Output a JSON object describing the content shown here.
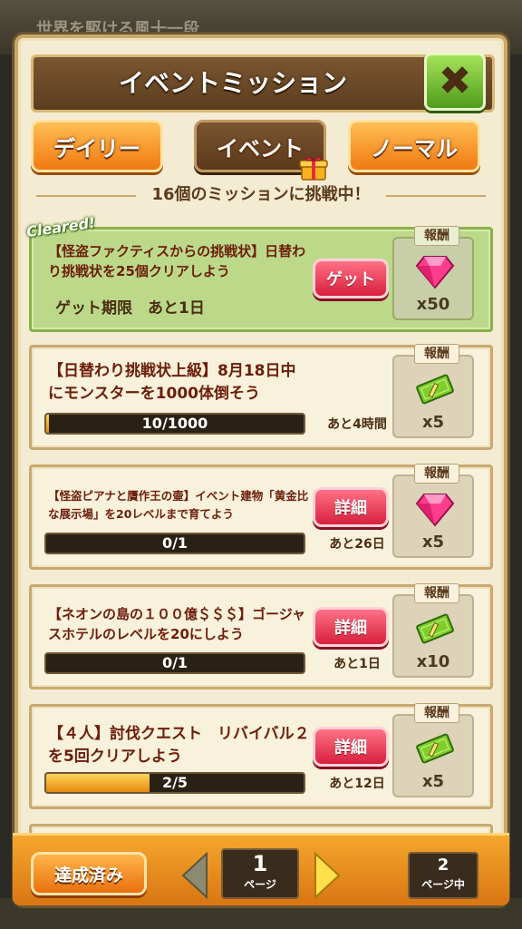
{
  "background": {
    "top_text": "世界を駆ける風十一段"
  },
  "header": {
    "title": "イベントミッション",
    "close_icon": "close-x-icon"
  },
  "tabs": [
    {
      "label": "デイリー",
      "active": false
    },
    {
      "label": "イベント",
      "active": true
    },
    {
      "label": "ノーマル",
      "active": false
    }
  ],
  "subtitle": "16個のミッションに挑戦中！",
  "reward_label": "報酬",
  "missions": [
    {
      "title": "【怪盗ファクティスからの挑戦状】日替わり挑戦状を25個クリアしよう",
      "cleared_badge": "Cleared!",
      "deadline": "ゲット期限　あと1日",
      "button": "ゲット",
      "reward_icon": "gem-icon",
      "reward_qty": "x50"
    },
    {
      "title": "【日替わり挑戦状上級】8月18日中にモンスターを1000体倒そう",
      "progress_text": "10/1000",
      "progress_fraction": 0.01,
      "remaining": "あと4時間",
      "reward_icon": "ticket-icon",
      "reward_qty": "x5"
    },
    {
      "title": "【怪盗ピアナと贋作王の壷】イベント建物「黄金比な展示場」を20レベルまで育てよう",
      "button": "詳細",
      "progress_text": "0/1",
      "progress_fraction": 0,
      "remaining": "あと26日",
      "reward_icon": "gem-icon",
      "reward_qty": "x5"
    },
    {
      "title": "【ネオンの島の１００億＄＄＄】ゴージャスホテルのレベルを20にしよう",
      "button": "詳細",
      "progress_text": "0/1",
      "progress_fraction": 0,
      "remaining": "あと1日",
      "reward_icon": "ticket-icon",
      "reward_qty": "x10"
    },
    {
      "title": "【４人】討伐クエスト　リバイバル２を5回クリアしよう",
      "button": "詳細",
      "progress_text": "2/5",
      "progress_fraction": 0.4,
      "remaining": "あと12日",
      "reward_icon": "ticket-icon",
      "reward_qty": "x5"
    }
  ],
  "footer": {
    "done_button": "達成済み",
    "current_page": "1",
    "page_label": "ページ",
    "total_pages": "2",
    "total_label": "ページ中"
  },
  "colors": {
    "accent_orange": "#f07a10",
    "cleared_green": "#bcd98a",
    "button_red": "#d7203d",
    "close_green": "#4e9c1a"
  }
}
